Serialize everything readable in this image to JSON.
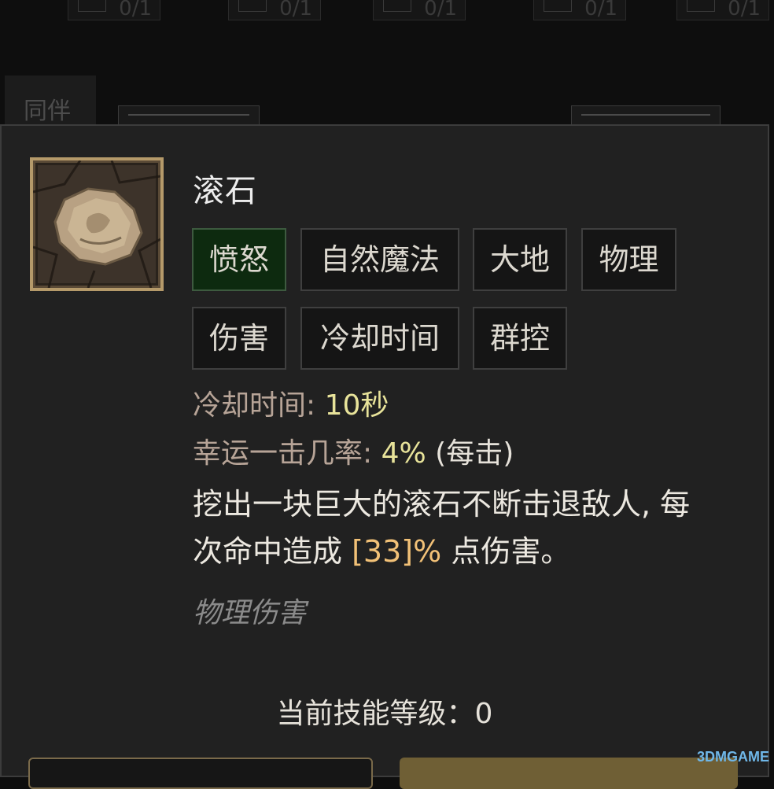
{
  "background": {
    "slots": [
      "0/1",
      "0/1",
      "0/1",
      "0/1",
      "0/1"
    ],
    "tab_label": "同伴"
  },
  "skill": {
    "name": "滚石",
    "tags": [
      "愤怒",
      "自然魔法",
      "大地",
      "物理",
      "伤害",
      "冷却时间",
      "群控"
    ],
    "cooldown_label": "冷却时间:",
    "cooldown_value": "10秒",
    "lucky_hit_label": "幸运一击几率:",
    "lucky_hit_value": "4%",
    "lucky_hit_suffix": "(每击)",
    "description_line1": "挖出一块巨大的滚石不断击退敌人, 每",
    "description_line2_a": "次命中造成",
    "description_value": "[33]%",
    "description_line2_b": "点伤害。",
    "damage_type": "物理伤害",
    "level_text": "当前技能等级：0"
  },
  "watermark": "3DMGAME",
  "colors": {
    "panel_bg": "#212121",
    "active_tag_bg": "#0d2a0f",
    "value_yellow": "#e8e39a",
    "highlight_orange": "#f2c177"
  }
}
